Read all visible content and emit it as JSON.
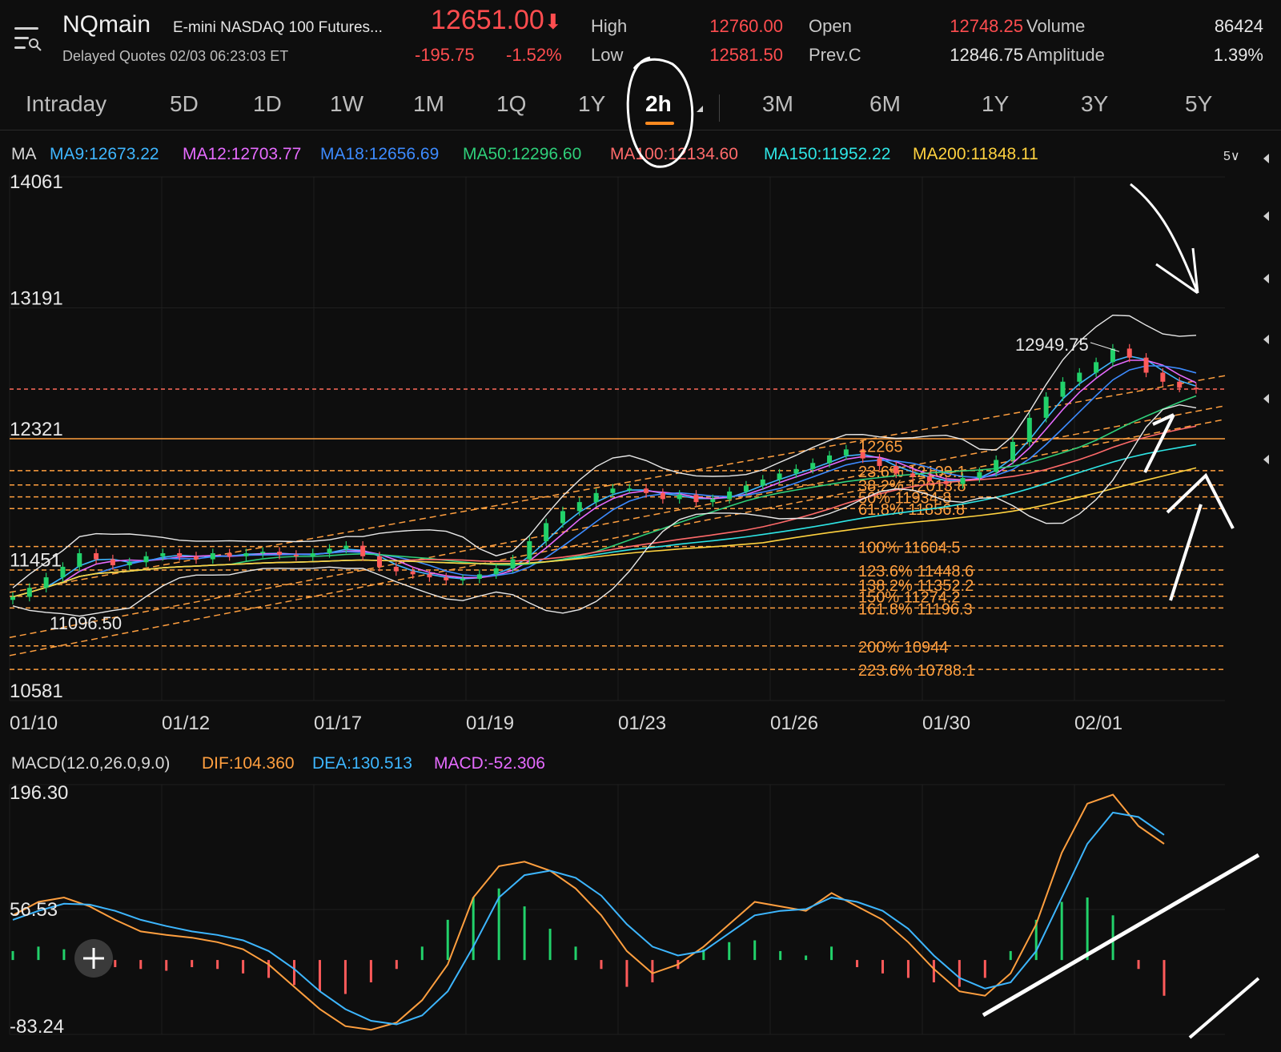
{
  "header": {
    "symbol": "NQmain",
    "full_name": "E-mini NASDAQ 100 Futures...",
    "delayed": "Delayed Quotes  02/03 06:23:03 ET",
    "price": "12651.00",
    "price_arrow": "⬇",
    "change": "-195.75",
    "change_pct": "-1.52%",
    "stats": [
      {
        "label": "High",
        "value": "12760.00",
        "color": "red"
      },
      {
        "label": "Low",
        "value": "12581.50",
        "color": "red"
      },
      {
        "label": "Open",
        "value": "12748.25",
        "color": "red"
      },
      {
        "label": "Prev.C",
        "value": "12846.75",
        "color": "white"
      },
      {
        "label": "Volume",
        "value": "86424",
        "color": "white"
      },
      {
        "label": "Amplitude",
        "value": "1.39%",
        "color": "white"
      }
    ]
  },
  "tabs": [
    "Intraday",
    "5D",
    "1D",
    "1W",
    "1M",
    "1Q",
    "1Y",
    "2h",
    "3M",
    "6M",
    "1Y",
    "3Y",
    "5Y"
  ],
  "active_tab": "2h",
  "ma_legend": {
    "title": "MA",
    "items": [
      {
        "label": "MA9:12673.22",
        "color": "#3fb6ff"
      },
      {
        "label": "MA12:12703.77",
        "color": "#e66bff"
      },
      {
        "label": "MA18:12656.69",
        "color": "#3d8bff"
      },
      {
        "label": "MA50:12296.60",
        "color": "#2fcf7a"
      },
      {
        "label": "MA100:12134.60",
        "color": "#ff6a6a"
      },
      {
        "label": "MA150:11952.22",
        "color": "#2ee6e6"
      },
      {
        "label": "MA200:11848.11",
        "color": "#ffd23f"
      }
    ],
    "period_button": "5∨"
  },
  "chart_data": [
    {
      "type": "candlestick",
      "title": "NQmain 2h",
      "y_ticks": [
        "14061",
        "13191",
        "12321",
        "11451",
        "10581"
      ],
      "ylim": [
        10581,
        14061
      ],
      "x_ticks": [
        "01/10",
        "01/12",
        "01/17",
        "01/19",
        "01/23",
        "01/26",
        "01/30",
        "02/01"
      ],
      "annotations": {
        "high_label": "12949.75",
        "low_label": "11096.50",
        "swing_high_label": "12265"
      },
      "fibonacci": [
        {
          "label": "23.6% 12109.1",
          "value": 12109.1
        },
        {
          "label": "38.2% 12013.8",
          "value": 12013.8
        },
        {
          "label": "50% 11934.8",
          "value": 11934.8
        },
        {
          "label": "61.8% 11856.8",
          "value": 11856.8
        },
        {
          "label": "100% 11604.5",
          "value": 11604.5
        },
        {
          "label": "123.6% 11448.6",
          "value": 11448.6
        },
        {
          "label": "138.2% 11352.2",
          "value": 11352.2
        },
        {
          "label": "150% 11274.2",
          "value": 11274.2
        },
        {
          "label": "161.8% 11196.3",
          "value": 11196.3
        },
        {
          "label": "200% 10944",
          "value": 10944
        },
        {
          "label": "223.6% 10788.1",
          "value": 10788.1
        }
      ],
      "horizontal_levels": [
        12321,
        12651
      ],
      "close_series": [
        11270,
        11330,
        11400,
        11470,
        11560,
        11520,
        11480,
        11500,
        11540,
        11560,
        11540,
        11520,
        11560,
        11540,
        11560,
        11570,
        11550,
        11540,
        11560,
        11590,
        11610,
        11540,
        11470,
        11440,
        11420,
        11400,
        11380,
        11390,
        11420,
        11460,
        11520,
        11640,
        11760,
        11840,
        11900,
        11960,
        11990,
        11990,
        11960,
        11920,
        11950,
        11900,
        11920,
        11970,
        12010,
        12050,
        12090,
        12120,
        12160,
        12210,
        12250,
        12190,
        12140,
        12090,
        12070,
        12040,
        12020,
        12060,
        12100,
        12180,
        12300,
        12460,
        12600,
        12700,
        12760,
        12830,
        12920,
        12860,
        12760,
        12700,
        12660,
        12651
      ]
    },
    {
      "type": "macd",
      "title": "MACD(12.0,26.0,9.0)",
      "legend": [
        {
          "label": "MACD(12.0,26.0,9.0)",
          "color": "#d8d8d8"
        },
        {
          "label": "DIF:104.360",
          "color": "#ff9f3f"
        },
        {
          "label": "DEA:130.513",
          "color": "#3db6ff"
        },
        {
          "label": "MACD:-52.306",
          "color": "#e66bff"
        }
      ],
      "y_ticks": [
        "196.30",
        "56.53",
        "-83.24"
      ],
      "ylim": [
        -83.24,
        196.3
      ],
      "dif": [
        50,
        65,
        70,
        60,
        45,
        32,
        28,
        25,
        20,
        12,
        -5,
        -30,
        -55,
        -74,
        -78,
        -70,
        -45,
        -5,
        70,
        105,
        110,
        100,
        80,
        50,
        10,
        -15,
        -5,
        15,
        40,
        65,
        60,
        55,
        75,
        60,
        45,
        20,
        -10,
        -35,
        -40,
        -15,
        40,
        120,
        175,
        185,
        150,
        130
      ],
      "dea": [
        45,
        55,
        63,
        62,
        55,
        45,
        38,
        32,
        28,
        22,
        10,
        -10,
        -35,
        -55,
        -68,
        -72,
        -62,
        -35,
        15,
        70,
        95,
        100,
        92,
        72,
        40,
        15,
        5,
        10,
        30,
        50,
        55,
        57,
        70,
        65,
        55,
        35,
        5,
        -20,
        -32,
        -25,
        10,
        70,
        130,
        165,
        160,
        140
      ],
      "hist": [
        10,
        15,
        12,
        5,
        -8,
        -10,
        -12,
        -8,
        -10,
        -15,
        -20,
        -28,
        -35,
        -38,
        -25,
        -10,
        15,
        45,
        70,
        80,
        60,
        35,
        15,
        -10,
        -30,
        -25,
        -10,
        12,
        20,
        22,
        10,
        5,
        15,
        -8,
        -15,
        -20,
        -25,
        -30,
        -20,
        10,
        45,
        65,
        70,
        50,
        -10,
        -40
      ]
    }
  ]
}
